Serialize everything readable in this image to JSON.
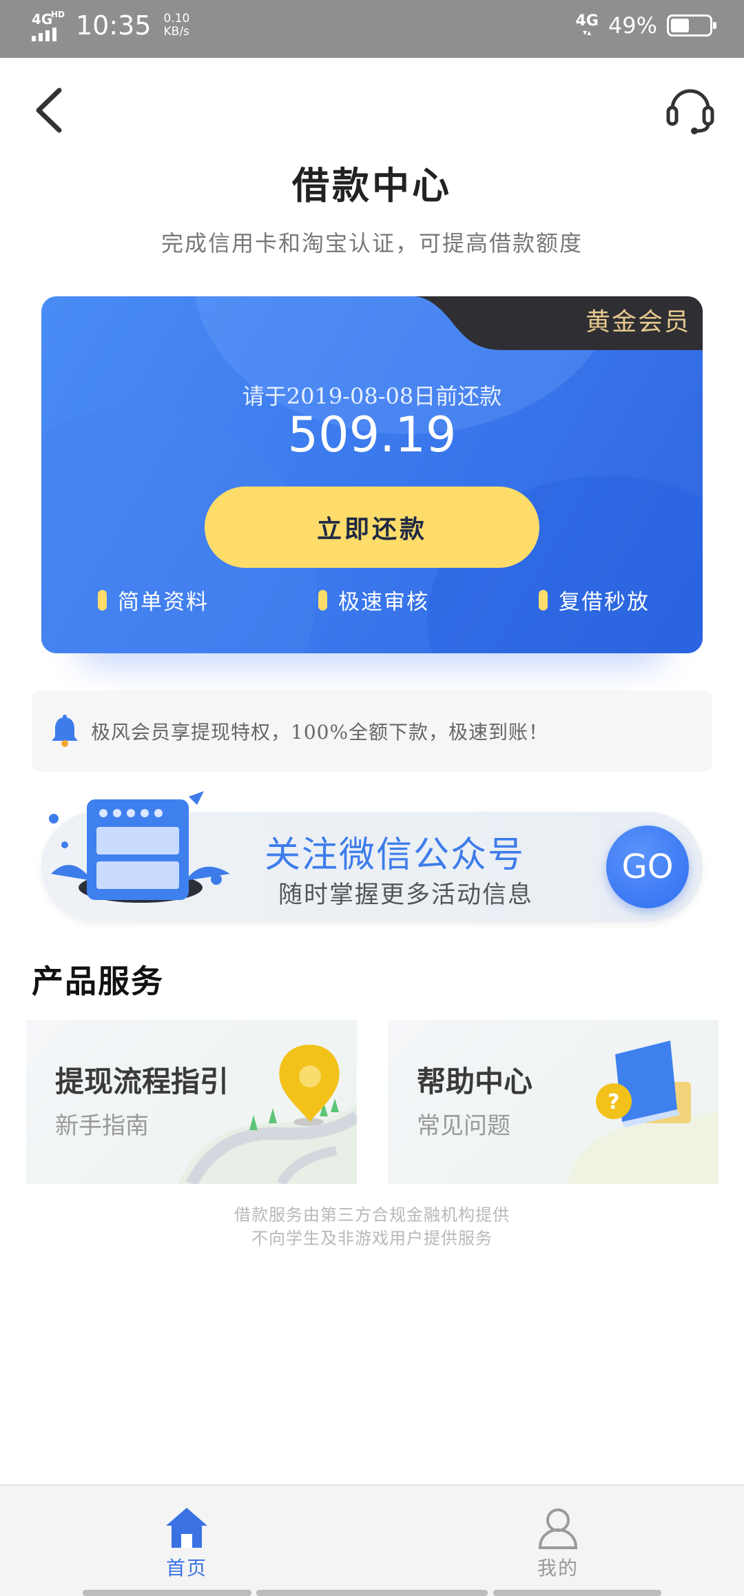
{
  "status_bar": {
    "network": "4G",
    "network_suffix": "HD",
    "time": "10:35",
    "speed_value": "0.10",
    "speed_unit": "KB/s",
    "network_right": "4G",
    "battery_percent": "49%",
    "battery_level": 0.49
  },
  "header": {
    "back_icon": "chevron-left-icon",
    "support_icon": "headset-icon",
    "title": "借款中心",
    "subtitle": "完成信用卡和淘宝认证，可提高借款额度"
  },
  "repay_card": {
    "badge": "黄金会员",
    "due_text": "请于2019-08-08日前还款",
    "amount": "509.19",
    "button_label": "立即还款",
    "features": [
      "简单资料",
      "极速审核",
      "复借秒放"
    ],
    "accent_color": "#fedc6a",
    "card_color": "#3c7bee"
  },
  "notice": {
    "icon": "bell-icon",
    "text": "极风会员享提现特权，100%全额下款，极速到账！"
  },
  "wechat_banner": {
    "title": "关注微信公众号",
    "subtitle": "随时掌握更多活动信息",
    "button_label": "GO"
  },
  "services": {
    "section_title": "产品服务",
    "items": [
      {
        "title": "提现流程指引",
        "subtitle": "新手指南",
        "icon": "map-pin-icon"
      },
      {
        "title": "帮助中心",
        "subtitle": "常见问题",
        "icon": "book-question-icon"
      }
    ]
  },
  "disclaimer": {
    "line1": "借款服务由第三方合规金融机构提供",
    "line2": "不向学生及非游戏用户提供服务"
  },
  "tabbar": {
    "items": [
      {
        "label": "首页",
        "icon": "home-icon",
        "active": true
      },
      {
        "label": "我的",
        "icon": "user-icon",
        "active": false
      }
    ]
  }
}
